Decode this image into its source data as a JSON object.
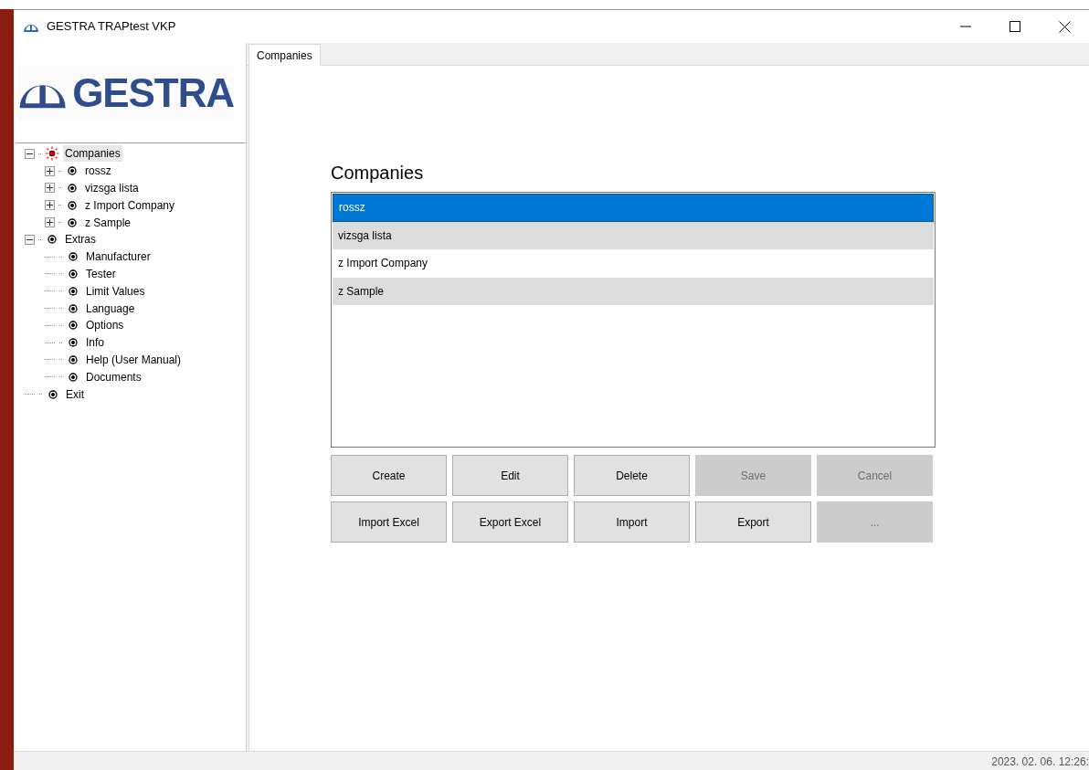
{
  "window": {
    "title": "GESTRA TRAPtest VKP"
  },
  "logo": {
    "text": "GESTRA"
  },
  "tree": [
    {
      "label": "Companies",
      "kind": "active",
      "selected": true,
      "expanded": true,
      "children": [
        {
          "label": "rossz",
          "kind": "item",
          "selected": false,
          "expanded": false
        },
        {
          "label": "vizsga lista",
          "kind": "item",
          "selected": false,
          "expanded": false
        },
        {
          "label": "z Import Company",
          "kind": "item",
          "selected": false,
          "expanded": false
        },
        {
          "label": "z Sample",
          "kind": "item",
          "selected": false,
          "expanded": false
        }
      ]
    },
    {
      "label": "Extras",
      "kind": "item",
      "selected": false,
      "expanded": true,
      "children": [
        {
          "label": "Manufacturer",
          "kind": "item",
          "selected": false
        },
        {
          "label": "Tester",
          "kind": "item",
          "selected": false
        },
        {
          "label": "Limit Values",
          "kind": "item",
          "selected": false
        },
        {
          "label": "Language",
          "kind": "item",
          "selected": false
        },
        {
          "label": "Options",
          "kind": "item",
          "selected": false
        },
        {
          "label": "Info",
          "kind": "item",
          "selected": false
        },
        {
          "label": "Help (User Manual)",
          "kind": "item",
          "selected": false
        },
        {
          "label": "Documents",
          "kind": "item",
          "selected": false
        }
      ]
    },
    {
      "label": "Exit",
      "kind": "item",
      "selected": false
    }
  ],
  "tabs": [
    {
      "label": "Companies",
      "selected": true
    }
  ],
  "heading": "Companies",
  "list": [
    {
      "label": "rossz",
      "selected": true
    },
    {
      "label": "vizsga lista",
      "selected": false
    },
    {
      "label": "z Import Company",
      "selected": false
    },
    {
      "label": "z Sample",
      "selected": false
    }
  ],
  "buttons": [
    [
      {
        "label": "Create",
        "disabled": false
      },
      {
        "label": "Edit",
        "disabled": false
      },
      {
        "label": "Delete",
        "disabled": false
      },
      {
        "label": "Save",
        "disabled": true
      },
      {
        "label": "Cancel",
        "disabled": true
      }
    ],
    [
      {
        "label": "Import Excel",
        "disabled": false
      },
      {
        "label": "Export Excel",
        "disabled": false
      },
      {
        "label": "Import",
        "disabled": false
      },
      {
        "label": "Export",
        "disabled": false
      },
      {
        "label": "...",
        "disabled": true
      }
    ]
  ],
  "status_bar": {
    "datetime": "2023. 02. 06. 12:26:"
  }
}
